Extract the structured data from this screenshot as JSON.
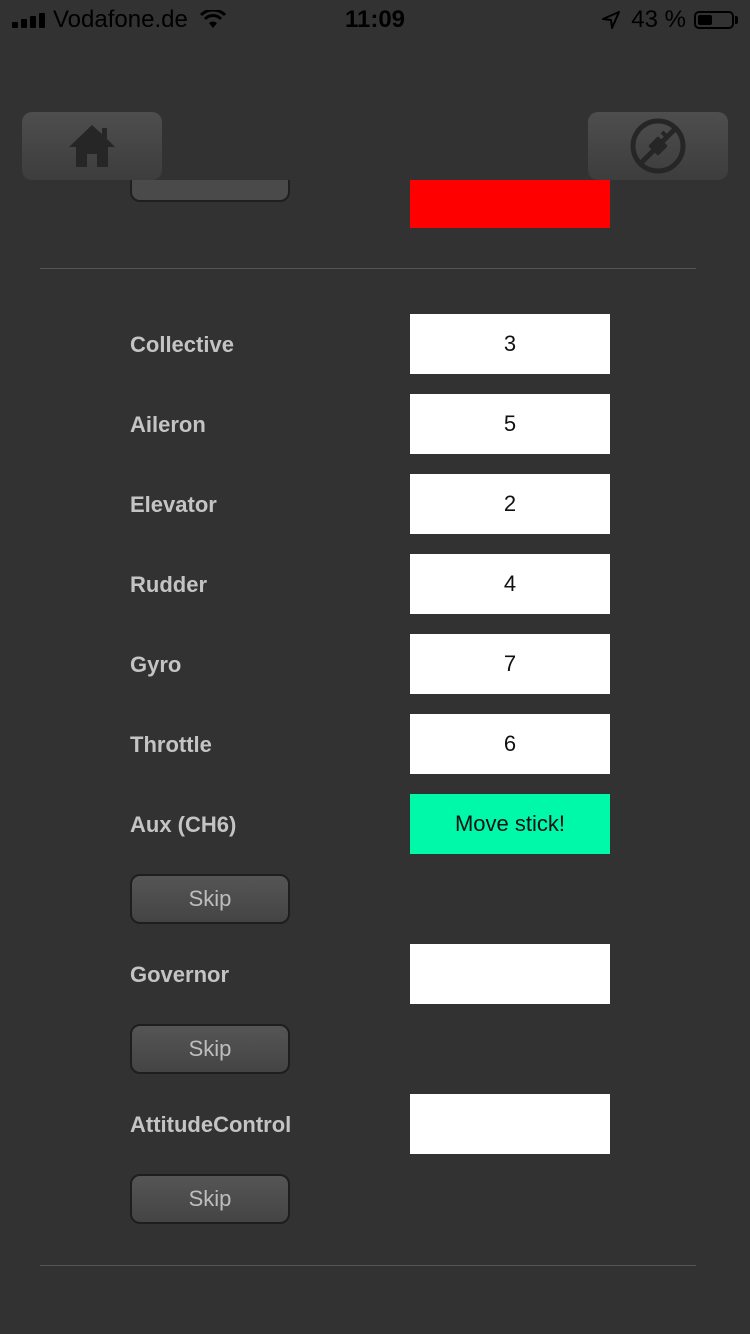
{
  "status_bar": {
    "carrier": "Vodafone.de",
    "time": "11:09",
    "battery_percent": "43 %",
    "battery_level": 0.43
  },
  "nav": {
    "home_icon": "home-icon",
    "disconnect_icon": "disconnect-icon"
  },
  "colors": {
    "background": "#323232",
    "active_box": "#00f9a8",
    "warning_box": "#ff0000"
  },
  "channels": [
    {
      "label": "Collective",
      "value": "3"
    },
    {
      "label": "Aileron",
      "value": "5"
    },
    {
      "label": "Elevator",
      "value": "2"
    },
    {
      "label": "Rudder",
      "value": "4"
    },
    {
      "label": "Gyro",
      "value": "7"
    },
    {
      "label": "Throttle",
      "value": "6"
    },
    {
      "label": "Aux (CH6)",
      "value": "Move stick!",
      "skip_label": "Skip"
    },
    {
      "label": "Governor",
      "value": "",
      "skip_label": "Skip"
    },
    {
      "label": "AttitudeControl",
      "value": "",
      "skip_label": "Skip"
    }
  ]
}
